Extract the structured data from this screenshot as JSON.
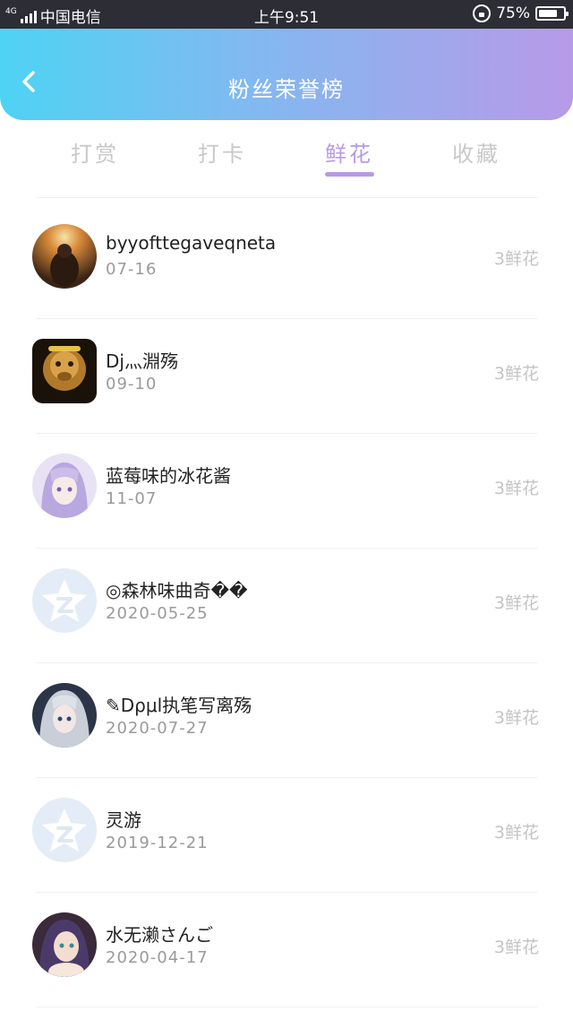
{
  "status_bar": {
    "network": "4G",
    "carrier": "中国电信",
    "time": "上午9:51",
    "battery": "75%",
    "battery_level": 0.75
  },
  "header": {
    "title": "粉丝荣誉榜",
    "back_icon": "chevron-left-icon"
  },
  "tabs": [
    {
      "label": "打赏",
      "active": false
    },
    {
      "label": "打卡",
      "active": false
    },
    {
      "label": "鲜花",
      "active": true
    },
    {
      "label": "收藏",
      "active": false
    }
  ],
  "fans": [
    {
      "name": "byyofttegaveqneta",
      "date": "07-16",
      "count": "3鲜花",
      "avatar": "sunset-photo"
    },
    {
      "name": "Dj灬淵殇",
      "date": "09-10",
      "count": "3鲜花",
      "avatar": "monkey-king"
    },
    {
      "name": "蓝莓味的冰花酱",
      "date": "11-07",
      "count": "3鲜花",
      "avatar": "anime-girl-purple"
    },
    {
      "name": "◎森林味曲奇��",
      "date": "2020-05-25",
      "count": "3鲜花",
      "avatar": "default-star"
    },
    {
      "name": "✎Dρμl执笔写离殇",
      "date": "2020-07-27",
      "count": "3鲜花",
      "avatar": "anime-girl-silver"
    },
    {
      "name": "灵游",
      "date": "2019-12-21",
      "count": "3鲜花",
      "avatar": "default-star"
    },
    {
      "name": "水无濑さんご",
      "date": "2020-04-17",
      "count": "3鲜花",
      "avatar": "anime-girl-dark"
    }
  ],
  "colors": {
    "accent": "#b79ae8",
    "gradient_start": "#4ed3f4",
    "gradient_end": "#b79ae8",
    "status_bar": "#2c2d35"
  }
}
